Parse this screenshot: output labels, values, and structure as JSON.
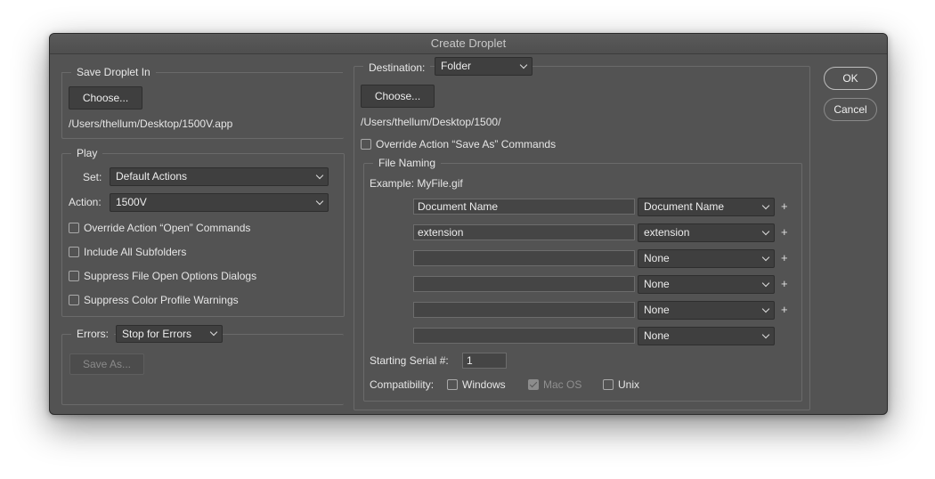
{
  "window": {
    "title": "Create Droplet"
  },
  "save_droplet": {
    "legend": "Save Droplet In",
    "choose_label": "Choose...",
    "path": "/Users/thellum/Desktop/1500V.app"
  },
  "play": {
    "legend": "Play",
    "set_label": "Set:",
    "set_value": "Default Actions",
    "action_label": "Action:",
    "action_value": "1500V",
    "options": [
      {
        "label": "Override Action “Open” Commands",
        "checked": false
      },
      {
        "label": "Include All Subfolders",
        "checked": false
      },
      {
        "label": "Suppress File Open Options Dialogs",
        "checked": false
      },
      {
        "label": "Suppress Color Profile Warnings",
        "checked": false
      }
    ]
  },
  "errors": {
    "label": "Errors:",
    "value": "Stop for Errors",
    "save_as_label": "Save As..."
  },
  "destination": {
    "label": "Destination:",
    "value": "Folder",
    "choose_label": "Choose...",
    "path": "/Users/thellum/Desktop/1500/",
    "override_label": "Override Action “Save As” Commands"
  },
  "file_naming": {
    "legend": "File Naming",
    "example": "Example: MyFile.gif",
    "rows": [
      {
        "text": "Document Name",
        "select": "Document Name",
        "plus": "+"
      },
      {
        "text": "extension",
        "select": "extension",
        "plus": "+"
      },
      {
        "text": "",
        "select": "None",
        "plus": "+"
      },
      {
        "text": "",
        "select": "None",
        "plus": "+"
      },
      {
        "text": "",
        "select": "None",
        "plus": "+"
      },
      {
        "text": "",
        "select": "None",
        "plus": ""
      }
    ],
    "serial_label": "Starting Serial #:",
    "serial_value": "1",
    "compat_label": "Compatibility:",
    "compat": [
      {
        "label": "Windows",
        "checked": false,
        "disabled": false
      },
      {
        "label": "Mac OS",
        "checked": true,
        "disabled": true
      },
      {
        "label": "Unix",
        "checked": false,
        "disabled": false
      }
    ]
  },
  "buttons": {
    "ok": "OK",
    "cancel": "Cancel"
  }
}
